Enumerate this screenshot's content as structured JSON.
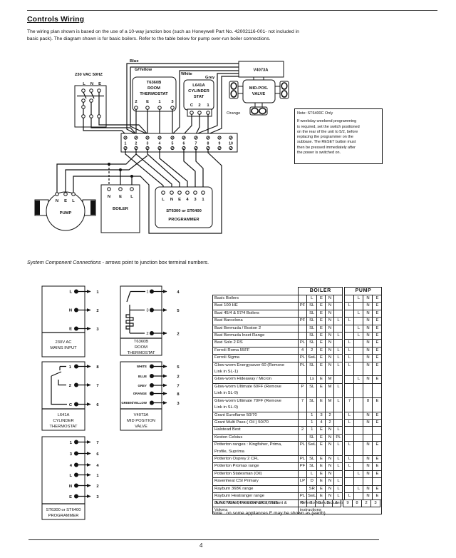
{
  "page": {
    "heading": "Controls Wiring",
    "intro_lines": [
      "The wiring plan shown is based on the use of a 10-way junction box (such as Honeywell Part No. 42002116-001- not included in",
      "basic pack). The diagram shown is for basic boilers. Refer to the table below for pump over-run boiler connections."
    ],
    "page_number": "4"
  },
  "wiring": {
    "supply": {
      "label": "230 VAC 50HZ",
      "terminals": [
        "L",
        "N",
        "E"
      ]
    },
    "wire_labels": {
      "blue": "Blue",
      "green_yellow": "G/Yellow",
      "white": "White",
      "grey": "Grey",
      "orange": "Orange"
    },
    "room_thermostat": {
      "lines": [
        "T6360B",
        "ROOM",
        "THERMOSTAT"
      ],
      "terminals": [
        "2",
        "E",
        "1",
        "3"
      ]
    },
    "cylinder_stat": {
      "lines": [
        "L641A",
        "CYLINDER",
        "STAT"
      ],
      "terminals": [
        "C",
        "2",
        "1"
      ]
    },
    "actuator": "V4073A",
    "valve": {
      "lines": [
        "MID-POS.",
        "VALVE"
      ]
    },
    "junction_box": {
      "terminals": [
        "1",
        "2",
        "3",
        "4",
        "5",
        "6",
        "7",
        "8",
        "9",
        "10"
      ]
    },
    "pump": {
      "label": "PUMP",
      "terminals": [
        "N",
        "E",
        "L"
      ]
    },
    "boiler": {
      "label": "BOILER",
      "terminals": [
        "N",
        "E",
        "L"
      ]
    },
    "programmer": {
      "lines": [
        "ST6300 or ST6400",
        "PROGRAMMER"
      ],
      "terminals": [
        "L",
        "N",
        "E",
        "4",
        "3",
        "1"
      ]
    },
    "note": {
      "title": "Note: ST6400C Only",
      "lines": [
        "If weekday-weekend programming",
        "is required, set the switch positioned",
        "on the rear of the unit to 5/2, before",
        "replacing the programmer on the",
        "subbase. The RESET button must",
        "then be pressed immediately after",
        "the power is switched on."
      ]
    }
  },
  "components": {
    "caption": {
      "italic": "System Component Connections",
      "rest": " - arrows point to junction box terminal numbers."
    },
    "mains": {
      "title": [
        "230V AC",
        "MAINS INPUT"
      ],
      "connections": [
        {
          "terminal": "L",
          "to": "1"
        },
        {
          "terminal": "N",
          "to": "2"
        },
        {
          "terminal": "E",
          "to": "3"
        }
      ]
    },
    "room_thermostat": {
      "title": [
        "T6360B",
        "ROOM",
        "THERMOSTAT"
      ],
      "connections": [
        {
          "terminal": "1",
          "to": "4"
        },
        {
          "terminal": "3",
          "to": "5"
        },
        {
          "terminal": "2",
          "to": "2"
        }
      ]
    },
    "cylinder_thermostat": {
      "title": [
        "L641A",
        "CYLINDER",
        "THERMOSTAT"
      ],
      "connections": [
        {
          "terminal": "1",
          "to": "8"
        },
        {
          "terminal": "2",
          "to": "7"
        },
        {
          "terminal": "C",
          "to": "6"
        }
      ]
    },
    "valve": {
      "title": [
        "V4073A",
        "MID POSITION",
        "VALVE"
      ],
      "connections": [
        {
          "terminal": "WHITE",
          "to": "5"
        },
        {
          "terminal": "BLUE",
          "to": "2"
        },
        {
          "terminal": "GREY",
          "to": "7"
        },
        {
          "terminal": "ORANGE",
          "to": "8"
        },
        {
          "terminal": "GREEN/YELLOW",
          "to": "3"
        }
      ]
    },
    "programmer": {
      "title": [
        "ST6300 or ST6400",
        "PROGRAMMER"
      ],
      "connections": [
        {
          "terminal": "1",
          "to": "7"
        },
        {
          "terminal": "3",
          "to": "6"
        },
        {
          "terminal": "4",
          "to": "4"
        },
        {
          "terminal": "L",
          "to": "1"
        },
        {
          "terminal": "N",
          "to": "2"
        },
        {
          "terminal": "E",
          "to": "3"
        }
      ]
    }
  },
  "table": {
    "headers": {
      "boiler": "BOILER",
      "pump": "PUMP"
    },
    "rows": [
      {
        "name": "Basic Boilers",
        "boiler": [
          "",
          "L",
          "E",
          "N",
          ""
        ],
        "pump": [
          "",
          "L",
          "N",
          "E"
        ]
      },
      {
        "name": "Baxi 100 HE",
        "boiler": [
          "PF",
          "SL",
          "E",
          "N",
          ""
        ],
        "pump": [
          "L",
          "",
          "N",
          "E"
        ]
      },
      {
        "name": "Baxi 45/4 & 57/4 Boilers",
        "boiler": [
          "",
          "SL",
          "E",
          "N",
          ""
        ],
        "pump": [
          "",
          "L",
          "N",
          "E"
        ]
      },
      {
        "name": "Baxi Barcelona",
        "boiler": [
          "PF",
          "SL",
          "E",
          "N",
          "L"
        ],
        "pump": [
          "L",
          "",
          "N",
          "E"
        ]
      },
      {
        "name": "Baxi Bermuda / Boston 2",
        "boiler": [
          "",
          "SL",
          "E",
          "N",
          ""
        ],
        "pump": [
          "",
          "L",
          "N",
          "E"
        ]
      },
      {
        "name": "Baxi Bermuda Inset Range",
        "boiler": [
          "",
          "SL",
          "E",
          "N",
          "L"
        ],
        "pump": [
          "",
          "L",
          "N",
          "E"
        ]
      },
      {
        "name": "Baxi Solo 2 RS",
        "boiler": [
          "PL",
          "SL",
          "E",
          "N",
          ""
        ],
        "pump": [
          "L",
          "",
          "N",
          "E"
        ]
      },
      {
        "name": "Ferroli Roma 55FF",
        "boiler": [
          "4",
          "2",
          "E",
          "N",
          "L"
        ],
        "pump": [
          "L",
          "",
          "N",
          "E"
        ]
      },
      {
        "name": "Ferroli Sigma",
        "boiler": [
          "PL",
          "SwL",
          "E",
          "N",
          "L"
        ],
        "pump": [
          "L",
          "",
          "N",
          "E"
        ]
      },
      {
        "name": "Glow-worm Energysaver 60 (Remove\nLink in SL-1)",
        "boiler": [
          "PL",
          "SL",
          "E",
          "N",
          "L"
        ],
        "pump": [
          "L",
          "",
          "N",
          "E"
        ]
      },
      {
        "name": "Glow-worm Hideaway / Micron",
        "boiler": [
          "",
          "Ls",
          "E",
          "M",
          ""
        ],
        "pump": [
          "",
          "L",
          "N",
          "E"
        ]
      },
      {
        "name": "Glow-worm Ultimate 60FF (Remove\nLink in SL-9)",
        "boiler": [
          "P",
          "SL",
          "E",
          "M",
          "L"
        ],
        "pump": [
          "",
          "",
          "",
          ""
        ]
      },
      {
        "name": "Glow-worm Ultimate 70FF (Remove\nLink in SL-9)",
        "boiler": [
          "7",
          "SL",
          "E",
          "M",
          "L"
        ],
        "pump": [
          "7",
          "",
          "8",
          "E"
        ]
      },
      {
        "name": "Grant Euroflame 50/70",
        "boiler": [
          "",
          "1",
          "3",
          "2",
          ""
        ],
        "pump": [
          "L",
          "",
          "N",
          "E"
        ]
      },
      {
        "name": "Grant Multi Pass ( Oil ) 50/70",
        "boiler": [
          "",
          "1",
          "4",
          "2",
          ""
        ],
        "pump": [
          "L",
          "",
          "N",
          "E"
        ]
      },
      {
        "name": "Halstead Best",
        "boiler": [
          "2",
          "1",
          "E",
          "N",
          "L"
        ],
        "pump": [
          "",
          "",
          "",
          ""
        ]
      },
      {
        "name": "Keston Celsius",
        "boiler": [
          "",
          "SL",
          "E",
          "N",
          "PL"
        ],
        "pump": [
          "",
          "",
          "",
          ""
        ]
      },
      {
        "name": "Potterton ranges : Kingfisher, Prima,\nProfile, Suprima",
        "boiler": [
          "PL",
          "SwL",
          "E",
          "N",
          "L"
        ],
        "pump": [
          "L",
          "",
          "N",
          "E"
        ]
      },
      {
        "name": "Potterton Osprey 2 CFL",
        "boiler": [
          "PL",
          "SL",
          "E",
          "N",
          "L"
        ],
        "pump": [
          "L",
          "",
          "N",
          "E"
        ]
      },
      {
        "name": "Potterton Promax range",
        "boiler": [
          "PF",
          "SL",
          "E",
          "N",
          "L"
        ],
        "pump": [
          "L",
          "",
          "N",
          "E"
        ]
      },
      {
        "name": "Potterton Statesman (Oil)",
        "boiler": [
          "",
          "L",
          "E",
          "N",
          ""
        ],
        "pump": [
          "",
          "L",
          "N",
          "E"
        ]
      },
      {
        "name": "Ravenheat CSI Primary",
        "boiler": [
          "LP",
          "D",
          "E",
          "N",
          "L"
        ],
        "pump": [
          "",
          "",
          "",
          ""
        ]
      },
      {
        "name": "Rayburn 368K range",
        "boiler": [
          "",
          "SR",
          "E",
          "N",
          "L"
        ],
        "pump": [
          "",
          "L",
          "N",
          "E"
        ]
      },
      {
        "name": "Rayburn Heatranger range",
        "boiler": [
          "PL",
          "SwL",
          "E",
          "N",
          "L"
        ],
        "pump": [
          "L",
          "",
          "N",
          "E"
        ]
      },
      {
        "name": "Burco Maxol, Potterton Ultra, Vaillant &\nVokera",
        "note": "Refer to Manufacturer's\ninstructions"
      }
    ],
    "junction": {
      "label": "JUNCTION BOX CONNECTIONS",
      "boiler": [
        "9",
        "8",
        "3",
        "2",
        "1"
      ],
      "pump": [
        "9",
        "8",
        "2",
        "3"
      ]
    },
    "footnote": "Note : on some appliances E may be shown as (earth)"
  }
}
